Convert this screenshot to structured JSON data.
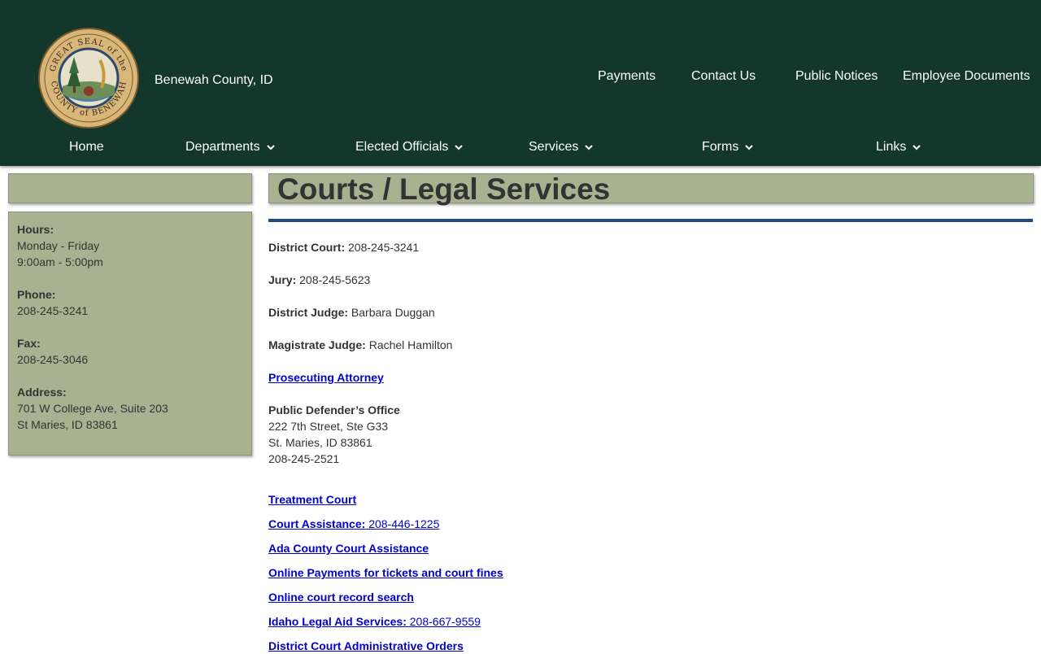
{
  "header": {
    "site_name": "Benewah County, ID",
    "seal_text_top": "GREAT SEAL of the",
    "seal_text_bottom": "COUNTY of BENEWAH",
    "top_links": [
      "Payments",
      "Contact Us",
      "Public Notices",
      "Employee Documents"
    ],
    "nav": [
      "Home",
      "Departments",
      "Elected Officials",
      "Services",
      "Forms",
      "Links"
    ]
  },
  "sidebar": {
    "hours_label": "Hours:",
    "hours_days": "Monday - Friday",
    "hours_time": "9:00am - 5:00pm",
    "phone_label": "Phone:",
    "phone": "208-245-3241",
    "fax_label": "Fax:",
    "fax": "208-245-3046",
    "address_label": "Address:",
    "address_line1": "701 W College Ave, Suite 203",
    "address_line2": "St Maries, ID 83861"
  },
  "main": {
    "title": "Courts / Legal Services",
    "district_court_label": "District Court:",
    "district_court_phone": "208-245-3241",
    "jury_label": "Jury:",
    "jury_phone": "208-245-5623",
    "district_judge_label": "District Judge:",
    "district_judge": "Barbara Duggan",
    "magistrate_label": "Magistrate Judge:",
    "magistrate": "Rachel Hamilton",
    "prosecuting_attorney": "Prosecuting Attorney",
    "public_defender_label": "Public Defender’s Office",
    "pd_line1": "222 7th Street, Ste G33",
    "pd_line2": "St. Maries, ID 83861",
    "pd_phone": "208-245-2521",
    "links": {
      "treatment_court": "Treatment Court",
      "court_assistance": "Court Assistance:",
      "court_assistance_phone": "208-446-1225",
      "ada_county": "Ada County Court Assistance",
      "online_payments": "Online Payments for tickets and court fines",
      "record_search": "Online court record search",
      "legal_aid": "Idaho Legal Aid Services:",
      "legal_aid_phone": "208-667-9559",
      "admin_orders": "District Court Administrative Orders"
    }
  },
  "colors": {
    "header_bg": "#13372a",
    "panel_bg": "#a8b291",
    "rule": "#1b4f7f",
    "link": "#0000cc"
  }
}
